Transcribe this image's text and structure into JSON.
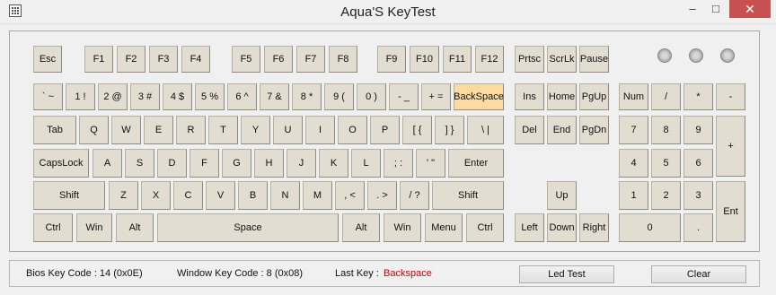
{
  "window": {
    "title": "Aqua'S KeyTest",
    "minimize": "–",
    "maximize": "□",
    "close": "✕",
    "icon": "keyboard-grid-icon"
  },
  "keys": {
    "esc": "Esc",
    "f1": "F1",
    "f2": "F2",
    "f3": "F3",
    "f4": "F4",
    "f5": "F5",
    "f6": "F6",
    "f7": "F7",
    "f8": "F8",
    "f9": "F9",
    "f10": "F10",
    "f11": "F11",
    "f12": "F12",
    "prtsc": "Prtsc",
    "scrlk": "ScrLk",
    "pause": "Pause",
    "backtick": "` ~",
    "d1": "1 !",
    "d2": "2 @",
    "d3": "3 #",
    "d4": "4 $",
    "d5": "5 %",
    "d6": "6 ^",
    "d7": "7 &",
    "d8": "8 *",
    "d9": "9 (",
    "d0": "0 )",
    "minus": "- _",
    "equal": "+ =",
    "backspace": "BackSpace",
    "ins": "Ins",
    "home": "Home",
    "pgup": "PgUp",
    "numlock": "Num",
    "np_div": "/",
    "np_mul": "*",
    "np_minus": "-",
    "tab": "Tab",
    "q": "Q",
    "w": "W",
    "e": "E",
    "r": "R",
    "t": "T",
    "y": "Y",
    "u": "U",
    "i": "I",
    "o": "O",
    "p": "P",
    "lbracket": "[ {",
    "rbracket": "] }",
    "backslash": "\\ |",
    "del": "Del",
    "end": "End",
    "pgdn": "PgDn",
    "np7": "7",
    "np8": "8",
    "np9": "9",
    "np_plus": "+",
    "capslock": "CapsLock",
    "a": "A",
    "s": "S",
    "d": "D",
    "f": "F",
    "g": "G",
    "h": "H",
    "j": "J",
    "k": "K",
    "l": "L",
    "semicolon": "; :",
    "quote": "' \"",
    "enter": "Enter",
    "np4": "4",
    "np5": "5",
    "np6": "6",
    "lshift": "Shift",
    "z": "Z",
    "x": "X",
    "c": "C",
    "v": "V",
    "b": "B",
    "n": "N",
    "m": "M",
    "comma": ", <",
    "period": ". >",
    "slash": "/ ?",
    "rshift": "Shift",
    "up": "Up",
    "np1": "1",
    "np2": "2",
    "np3": "3",
    "np_enter": "Ent",
    "lctrl": "Ctrl",
    "lwin": "Win",
    "lalt": "Alt",
    "space": "Space",
    "ralt": "Alt",
    "rwin": "Win",
    "menu": "Menu",
    "rctrl": "Ctrl",
    "left": "Left",
    "down": "Down",
    "right": "Right",
    "np0": "0",
    "np_dot": "."
  },
  "active_key": "backspace",
  "active_color": "#fbdba0",
  "status": {
    "bios_label": "Bios Key Code : 14 (0x0E)",
    "window_label": "Window Key Code : 8 (0x08)",
    "last_label": "Last Key :",
    "last_value": "Backspace",
    "last_value_color": "#cc0000",
    "led_test": "Led Test",
    "clear": "Clear"
  }
}
